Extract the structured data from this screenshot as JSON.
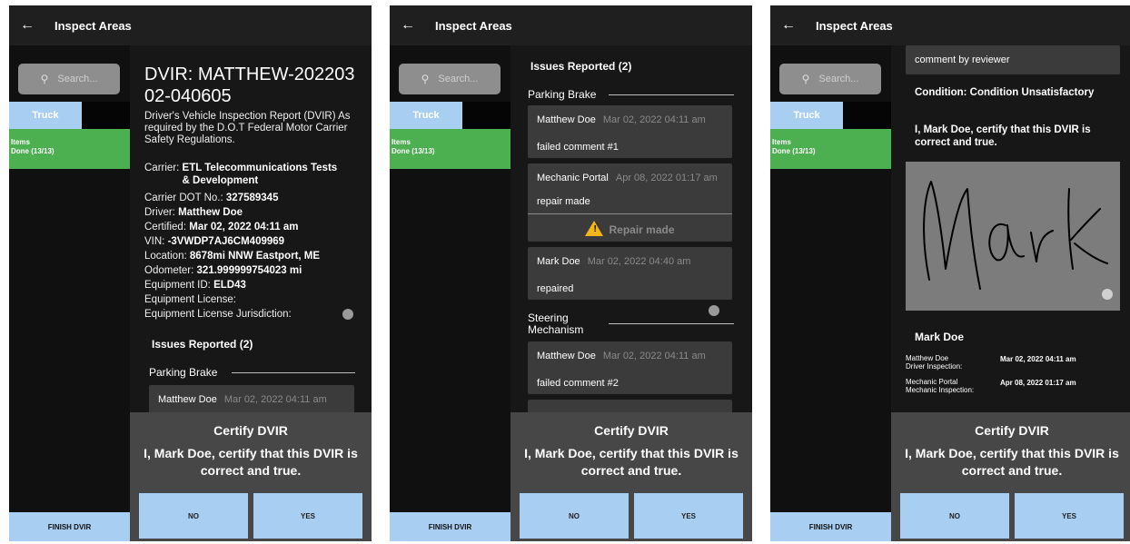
{
  "common": {
    "title": "Inspect Areas",
    "back_glyph": "←",
    "search_placeholder": "Search...",
    "tab_truck": "Truck",
    "items_label": "Items",
    "items_status": "Done (13/13)",
    "finish_label": "FINISH DVIR",
    "certify_title": "Certify DVIR",
    "certify_text": "I, Mark Doe, certify that this DVIR is correct and true.",
    "no_label": "NO",
    "yes_label": "YES",
    "accent_blue": "#a8cef2",
    "accent_green": "#4caf50"
  },
  "screen1": {
    "heading": "DVIR: MATTHEW-20220302-040605",
    "description": "Driver's Vehicle Inspection Report (DVIR) As required by the D.O.T Federal Motor Carrier Safety Regulations.",
    "details": [
      {
        "label": "Carrier:",
        "value": "ETL Telecommunications Tests & Development"
      },
      {
        "label": "Carrier DOT No.:",
        "value": "327589345"
      },
      {
        "label": "Driver:",
        "value": "Matthew Doe"
      },
      {
        "label": "Certified:",
        "value": "Mar 02, 2022  04:11 am"
      },
      {
        "label": "VIN:",
        "value": "-3VWDP7AJ6CM409969"
      },
      {
        "label": "Location:",
        "value": "8678mi NNW Eastport, ME"
      },
      {
        "label": "Odometer:",
        "value": "321.999999754023 mi"
      },
      {
        "label": "Equipment ID:",
        "value": "ELD43"
      },
      {
        "label": "Equipment License:",
        "value": ""
      },
      {
        "label": "Equipment License Jurisdiction:",
        "value": ""
      }
    ],
    "issues_heading": "Issues Reported (2)",
    "category": "Parking Brake",
    "card": {
      "author": "Matthew Doe",
      "time": "Mar 02, 2022  04:11 am"
    }
  },
  "screen2": {
    "issues_heading": "Issues Reported (2)",
    "category1": "Parking Brake",
    "cards": [
      {
        "author": "Matthew Doe",
        "time": "Mar 02, 2022  04:11 am",
        "message": "failed comment #1"
      },
      {
        "author": "Mechanic Portal",
        "time": "Apr 08, 2022  01:17 am",
        "message": "repair made",
        "status": "Repair made"
      },
      {
        "author": "Mark Doe",
        "time": "Mar 02, 2022  04:40 am",
        "message": "repaired"
      }
    ],
    "category2": "Steering Mechanism",
    "card4": {
      "author": "Matthew Doe",
      "time": "Mar 02, 2022  04:11 am",
      "message": "failed comment #2"
    }
  },
  "screen3": {
    "comment": "comment by reviewer",
    "condition": "Condition: Condition Unsatisfactory",
    "certify_statement": "I, Mark Doe, certify that this DVIR is correct and true.",
    "signature_text": "Mark",
    "signer_name": "Mark Doe",
    "inspections": [
      {
        "name": "Matthew Doe",
        "role": "Driver Inspection:",
        "time": "Mar 02, 2022  04:11 am"
      },
      {
        "name": "Mechanic Portal",
        "role": "Mechanic Inspection:",
        "time": "Apr 08, 2022  01:17 am"
      }
    ]
  }
}
